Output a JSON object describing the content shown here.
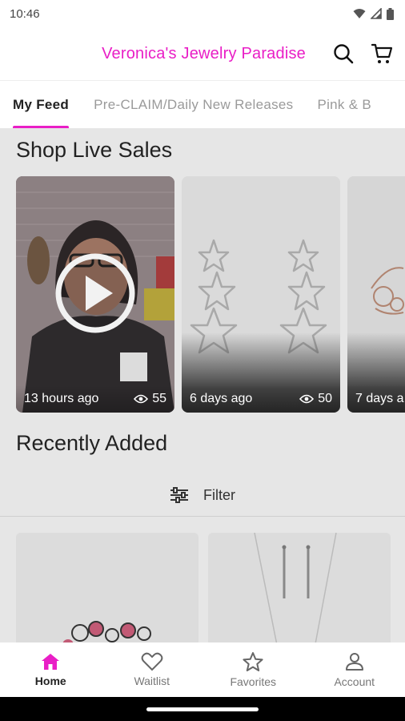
{
  "status_bar": {
    "time": "10:46"
  },
  "header": {
    "store_name": "Veronica's Jewelry Paradise",
    "icons": [
      "search-icon",
      "cart-icon"
    ],
    "accent_color": "#e91ec6"
  },
  "tabs": [
    {
      "label": "My Feed",
      "active": true
    },
    {
      "label": "Pre-CLAIM/Daily New Releases",
      "active": false
    },
    {
      "label": "Pink & B",
      "active": false
    }
  ],
  "live_sales": {
    "title": "Shop Live Sales",
    "cards": [
      {
        "time": "13 hours ago",
        "views": "55",
        "has_play": true
      },
      {
        "time": "6 days ago",
        "views": "50",
        "has_play": false
      },
      {
        "time": "7 days a",
        "views": "",
        "has_play": false
      }
    ]
  },
  "recently_added": {
    "title": "Recently Added",
    "filter_label": "Filter"
  },
  "bottom_nav": [
    {
      "label": "Home",
      "icon": "home-icon",
      "active": true
    },
    {
      "label": "Waitlist",
      "icon": "heart-icon",
      "active": false
    },
    {
      "label": "Favorites",
      "icon": "star-icon",
      "active": false
    },
    {
      "label": "Account",
      "icon": "account-icon",
      "active": false
    }
  ]
}
